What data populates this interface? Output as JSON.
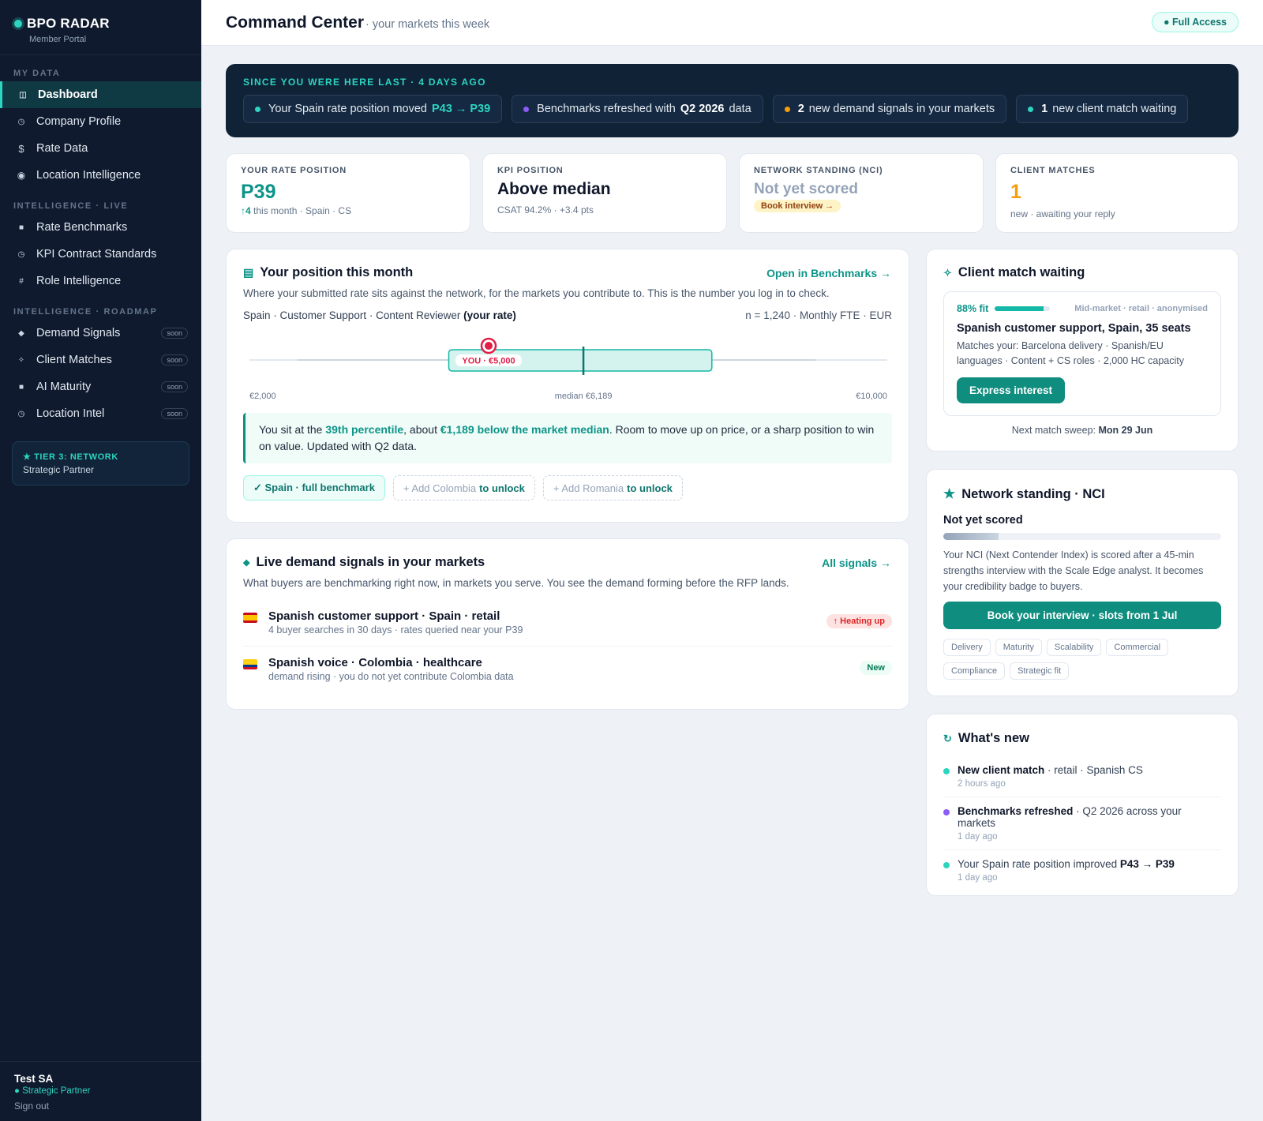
{
  "sidebar": {
    "brand": "BPO RADAR",
    "brand_sub": "Member Portal",
    "sections": [
      "MY DATA",
      "INTELLIGENCE · LIVE",
      "INTELLIGENCE · ROADMAP"
    ],
    "items": [
      {
        "label": "Dashboard",
        "icon": "dashboard-icon"
      },
      {
        "label": "Company Profile",
        "icon": "building-icon"
      },
      {
        "label": "Rate Data",
        "icon": "dollar-icon"
      },
      {
        "label": "Location Intelligence",
        "icon": "location-icon"
      },
      {
        "label": "Rate Benchmarks",
        "icon": "bars-icon"
      },
      {
        "label": "KPI Contract Standards",
        "icon": "target-icon"
      },
      {
        "label": "Role Intelligence",
        "icon": "hash-icon"
      },
      {
        "label": "Demand Signals",
        "icon": "diamond-icon",
        "badge": "soon"
      },
      {
        "label": "Client Matches",
        "icon": "sparkle-icon",
        "badge": "soon"
      },
      {
        "label": "AI Maturity",
        "icon": "square-icon",
        "badge": "soon"
      },
      {
        "label": "Location Intel",
        "icon": "pin-icon",
        "badge": "soon"
      }
    ],
    "tier_title": "★ TIER 3: NETWORK",
    "tier_sub": "Strategic Partner",
    "user_name": "Test SA",
    "user_role": "● Strategic Partner",
    "sign_out": "Sign out"
  },
  "header": {
    "title": "Command Center",
    "subtitle": "· your markets this week",
    "access": "● Full Access"
  },
  "banner": {
    "title": "SINCE YOU WERE HERE LAST · 4 DAYS AGO",
    "chips": [
      {
        "pre": "Your Spain rate position moved",
        "strong": "P43 → P39",
        "post": "",
        "color": "#2dd4bf"
      },
      {
        "pre": "Benchmarks refreshed with",
        "strong": "Q2 2026",
        "post": "data",
        "color": "#8b5cf6"
      },
      {
        "pre": "",
        "strong": "2",
        "post": "new demand signals in your markets",
        "color": "#f59e0b"
      },
      {
        "pre": "",
        "strong": "1",
        "post": "new client match waiting",
        "color": "#2dd4bf"
      }
    ]
  },
  "kpis": [
    {
      "label": "YOUR RATE POSITION",
      "value": "P39",
      "arrow": "↑4",
      "sub": " this month · Spain · CS"
    },
    {
      "label": "KPI POSITION",
      "value": "Above median",
      "sub": "CSAT 94.2% · +3.4 pts"
    },
    {
      "label": "NETWORK STANDING (NCI)",
      "value": "Not yet scored",
      "button": "Book interview →"
    },
    {
      "label": "CLIENT MATCHES",
      "value": "1",
      "sub": "new · awaiting your reply"
    }
  ],
  "position": {
    "title": "Your position this month",
    "link": "Open in Benchmarks →",
    "desc": "Where your submitted rate sits against the network, for the markets you contribute to. This is the number you log in to check.",
    "context": "Spain · Customer Support · Content Reviewer",
    "context_strong": "(your rate)",
    "meta": "n = 1,240 · Monthly FTE · EUR",
    "you_label": "YOU · €5,000",
    "axis_min": "€2,000",
    "axis_mid": "median €6,189",
    "axis_max": "€10,000",
    "range": {
      "min": 2000,
      "max": 10000,
      "whisker_low": 2600,
      "q1": 4500,
      "median": 6189,
      "q3": 7800,
      "whisker_high": 9100,
      "you": 5000
    },
    "insight_1": "You sit at the ",
    "insight_pct": "39th percentile",
    "insight_2": ", about ",
    "insight_diff": "€1,189 below the market median",
    "insight_3": ". Room to move up on price, or a sharp position to win on value. Updated with Q2 data.",
    "unlocked": "✓ Spain · full benchmark",
    "locks": [
      {
        "pre": "+ Add Colombia",
        "strong": "to unlock"
      },
      {
        "pre": "+ Add Romania",
        "strong": "to unlock"
      }
    ]
  },
  "signals": {
    "title": "Live demand signals in your markets",
    "link": "All signals →",
    "desc": "What buyers are benchmarking right now, in markets you serve. You see the demand forming before the RFP lands.",
    "items": [
      {
        "title": "Spanish customer support · Spain · retail",
        "sub": "4 buyer searches in 30 days · rates queried near your P39",
        "tag": "↑ Heating up"
      },
      {
        "title": "Spanish voice · Colombia · healthcare",
        "sub": "demand rising · you do not yet contribute Colombia data",
        "tag": "New"
      }
    ]
  },
  "client_match": {
    "title": "Client match waiting",
    "fit": "88% fit",
    "fit_value": 0.88,
    "segment": "Mid-market · retail · anonymised",
    "headline": "Spanish customer support, Spain, 35 seats",
    "matches": "Matches your: Barcelona delivery · Spanish/EU languages · Content + CS roles · 2,000 HC capacity",
    "button": "Express interest",
    "sweep_label": "Next match sweep:",
    "sweep_date": "Mon 29 Jun"
  },
  "nci": {
    "title": "Network standing · NCI",
    "status": "Not yet scored",
    "progress": 0.2,
    "desc": "Your NCI (Next Contender Index) is scored after a 45-min strengths interview with the Scale Edge analyst. It becomes your credibility badge to buyers.",
    "button": "Book your interview · slots from 1 Jul",
    "tags": [
      "Delivery",
      "Maturity",
      "Scalability",
      "Commercial",
      "Compliance",
      "Strategic fit"
    ]
  },
  "whats_new": {
    "title": "What's new",
    "items": [
      {
        "strong": "New client match",
        "text": " · retail · Spanish CS",
        "time": "2 hours ago",
        "color": "#2dd4bf"
      },
      {
        "strong": "Benchmarks refreshed",
        "text": " · Q2 2026 across your markets",
        "time": "1 day ago",
        "color": "#8b5cf6"
      },
      {
        "strong": "",
        "text": "Your Spain rate position improved ",
        "strong2": "P43 → P39",
        "time": "1 day ago",
        "color": "#2dd4bf"
      }
    ]
  }
}
